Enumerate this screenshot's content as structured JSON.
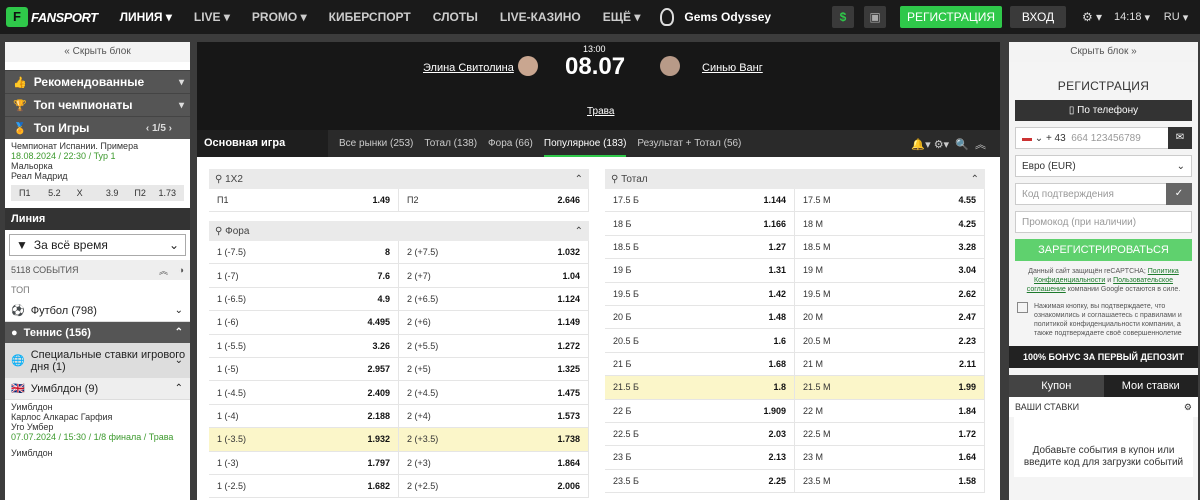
{
  "header": {
    "logo_text": "FANSPORT",
    "nav": [
      "ЛИНИЯ",
      "LIVE",
      "PROMO",
      "КИБЕРСПОРТ",
      "СЛОТЫ",
      "LIVE-КАЗИНО",
      "ЕЩЁ"
    ],
    "game": "Gems Odyssey",
    "dollar": "$",
    "register": "РЕГИСТРАЦИЯ",
    "login": "ВХОД",
    "time": "14:18",
    "lang": "RU"
  },
  "left": {
    "hide": "« Скрыть блок",
    "recommended": "Рекомендованные",
    "top_champ": "Топ чемпионаты",
    "top_games": "Топ Игры",
    "pager": "1/5",
    "match": {
      "league": "Чемпионат Испании. Примера",
      "meta": "18.08.2024 / 22:30 / Тур 1",
      "team1": "Мальорка",
      "team2": "Реал Мадрид",
      "odds": [
        [
          "П1",
          "5.2"
        ],
        [
          "X",
          "3.9"
        ],
        [
          "П2",
          "1.73"
        ]
      ]
    },
    "line_title": "Линия",
    "period": "За всё время",
    "events": "5118 СОБЫТИЯ",
    "top": "ТОП",
    "sports": [
      {
        "name": "Футбол",
        "count": "(798)"
      },
      {
        "name": "Теннис",
        "count": "(156)"
      },
      {
        "name": "Специальные ставки игрового дня",
        "count": "(1)"
      },
      {
        "name": "Уимблдон",
        "count": "(9)"
      }
    ],
    "wim_match": {
      "title": "Уимблдон",
      "p1": "Карлос Алкарас Гарфия",
      "p2": "Уго Умбер",
      "meta": "07.07.2024 / 15:30 / 1/8 финала / Трава"
    },
    "next_title": "Уимблдон"
  },
  "match": {
    "player1": "Элина Свитолина",
    "player2": "Синью Ванг",
    "time": "13:00",
    "date": "08.07",
    "surface": "Трава"
  },
  "tabs": {
    "main": "Основная игра",
    "items": [
      "Все рынки (253)",
      "Тотал (138)",
      "Фора (66)",
      "Популярное (183)",
      "Результат + Тотал (56)"
    ]
  },
  "m1x2": {
    "title": "1X2",
    "rows": [
      [
        "П1",
        "1.49",
        "П2",
        "2.646"
      ]
    ]
  },
  "fora": {
    "title": "Фора",
    "rows": [
      [
        "1 (-7.5)",
        "8",
        "2 (+7.5)",
        "1.032"
      ],
      [
        "1 (-7)",
        "7.6",
        "2 (+7)",
        "1.04"
      ],
      [
        "1 (-6.5)",
        "4.9",
        "2 (+6.5)",
        "1.124"
      ],
      [
        "1 (-6)",
        "4.495",
        "2 (+6)",
        "1.149"
      ],
      [
        "1 (-5.5)",
        "3.26",
        "2 (+5.5)",
        "1.272"
      ],
      [
        "1 (-5)",
        "2.957",
        "2 (+5)",
        "1.325"
      ],
      [
        "1 (-4.5)",
        "2.409",
        "2 (+4.5)",
        "1.475"
      ],
      [
        "1 (-4)",
        "2.188",
        "2 (+4)",
        "1.573"
      ],
      [
        "1 (-3.5)",
        "1.932",
        "2 (+3.5)",
        "1.738"
      ],
      [
        "1 (-3)",
        "1.797",
        "2 (+3)",
        "1.864"
      ],
      [
        "1 (-2.5)",
        "1.682",
        "2 (+2.5)",
        "2.006"
      ]
    ]
  },
  "total": {
    "title": "Тотал",
    "rows": [
      [
        "17.5 Б",
        "1.144",
        "17.5 М",
        "4.55"
      ],
      [
        "18 Б",
        "1.166",
        "18 М",
        "4.25"
      ],
      [
        "18.5 Б",
        "1.27",
        "18.5 М",
        "3.28"
      ],
      [
        "19 Б",
        "1.31",
        "19 М",
        "3.04"
      ],
      [
        "19.5 Б",
        "1.42",
        "19.5 М",
        "2.62"
      ],
      [
        "20 Б",
        "1.48",
        "20 М",
        "2.47"
      ],
      [
        "20.5 Б",
        "1.6",
        "20.5 М",
        "2.23"
      ],
      [
        "21 Б",
        "1.68",
        "21 М",
        "2.11"
      ],
      [
        "21.5 Б",
        "1.8",
        "21.5 М",
        "1.99"
      ],
      [
        "22 Б",
        "1.909",
        "22 М",
        "1.84"
      ],
      [
        "22.5 Б",
        "2.03",
        "22.5 М",
        "1.72"
      ],
      [
        "23 Б",
        "2.13",
        "23 М",
        "1.64"
      ],
      [
        "23.5 Б",
        "2.25",
        "23.5 М",
        "1.58"
      ]
    ]
  },
  "right": {
    "hide": "Скрыть блок »",
    "title": "РЕГИСТРАЦИЯ",
    "phone_btn": "По телефону",
    "code": "+ 43",
    "phone_ph": "664 123456789",
    "currency": "Евро (EUR)",
    "confirm_ph": "Код подтверждения",
    "promo_ph": "Промокод (при наличии)",
    "submit": "ЗАРЕГИСТРИРОВАТЬСЯ",
    "fine1": "Данный сайт защищён reCAPTCHA;",
    "fine_link1": "Политика Конфиденциальности",
    "fine_and": "и",
    "fine_link2": "Пользовательское соглашение",
    "fine2": "компании Google остаются в силе.",
    "agree": "Нажимая кнопку, вы подтверждаете, что ознакомились и соглашаетесь с правилами и политикой конфиденциальности компании, а также подтверждаете своё совершеннолетие",
    "bonus": "100% БОНУС ЗА ПЕРВЫЙ ДЕПОЗИТ",
    "coupon": "Купон",
    "mybets": "Мои ставки",
    "bets_title": "ВАШИ СТАВКИ",
    "empty": "Добавьте события в купон или введите код для загрузки событий"
  }
}
